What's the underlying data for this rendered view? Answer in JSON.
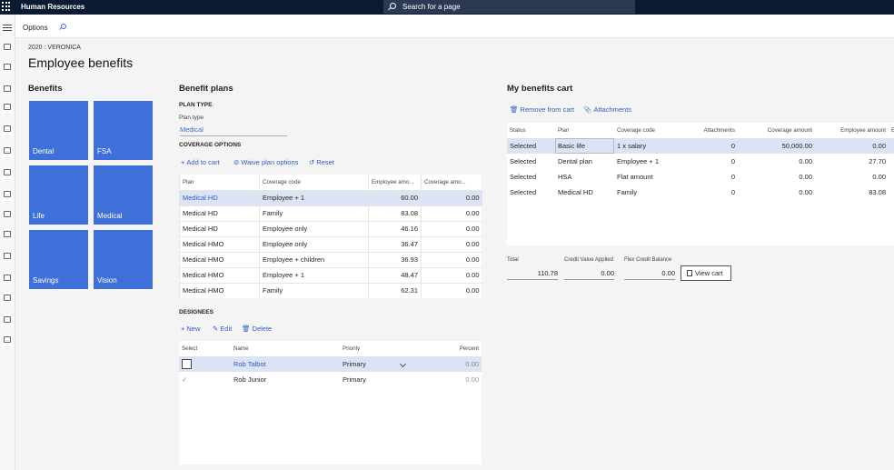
{
  "app": {
    "title": "Human Resources",
    "search_placeholder": "Search for a page"
  },
  "action_pane": {
    "options_label": "Options"
  },
  "breadcrumb": "2020 : VERONICA",
  "page_title": "Employee benefits",
  "benefits": {
    "title": "Benefits",
    "tiles": [
      "Dental",
      "FSA",
      "Life",
      "Medical",
      "Savings",
      "Vision"
    ],
    "tile_color": "#3f6fd8"
  },
  "benefit_plans": {
    "title": "Benefit plans",
    "plan_type_header": "PLAN TYPE",
    "plan_type_label": "Plan type",
    "plan_type_value": "Medical",
    "coverage_header": "COVERAGE OPTIONS",
    "actions": {
      "add": "Add to cart",
      "waive": "Waive plan options",
      "reset": "Reset"
    },
    "columns": [
      "Plan",
      "Coverage code",
      "Employee amo...",
      "Coverage amo..."
    ],
    "rows": [
      [
        "Medical HD",
        "Employee + 1",
        "60.00",
        "0.00"
      ],
      [
        "Medical HD",
        "Family",
        "83.08",
        "0.00"
      ],
      [
        "Medical HD",
        "Employee only",
        "46.16",
        "0.00"
      ],
      [
        "Medical HMO",
        "Employee only",
        "36.47",
        "0.00"
      ],
      [
        "Medical HMO",
        "Employee + children",
        "36.93",
        "0.00"
      ],
      [
        "Medical HMO",
        "Employee + 1",
        "48.47",
        "0.00"
      ],
      [
        "Medical HMO",
        "Family",
        "62.31",
        "0.00"
      ]
    ]
  },
  "designees": {
    "header": "DESIGNEES",
    "actions": {
      "new": "New",
      "edit": "Edit",
      "delete": "Delete"
    },
    "columns": [
      "Select",
      "Name",
      "Priority",
      "Percent"
    ],
    "rows": [
      [
        "",
        "Rob Talbot",
        "Primary",
        "0.00"
      ],
      [
        "✓",
        "Rob Junior",
        "Primary",
        "0.00"
      ]
    ]
  },
  "cart": {
    "title": "My benefits cart",
    "actions": {
      "remove": "Remove from cart",
      "attachments": "Attachments"
    },
    "columns": [
      "Status",
      "Plan",
      "Coverage code",
      "Attachments",
      "Coverage amount",
      "Employee amount",
      "E"
    ],
    "rows": [
      [
        "Selected",
        "Basic life",
        "1 x salary",
        "0",
        "50,000.00",
        "0.00"
      ],
      [
        "Selected",
        "Dental plan",
        "Employee + 1",
        "0",
        "0.00",
        "27.70"
      ],
      [
        "Selected",
        "HSA",
        "Flat amount",
        "0",
        "0.00",
        "0.00"
      ],
      [
        "Selected",
        "Medical HD",
        "Family",
        "0",
        "0.00",
        "83.08"
      ]
    ],
    "summary": {
      "total_label": "Total",
      "total_value": "110.78",
      "credit_label": "Credit Value Applied",
      "credit_value": "0.00",
      "flex_label": "Flex Credit Balance",
      "flex_value": "0.00",
      "view_cart": "View cart"
    }
  }
}
